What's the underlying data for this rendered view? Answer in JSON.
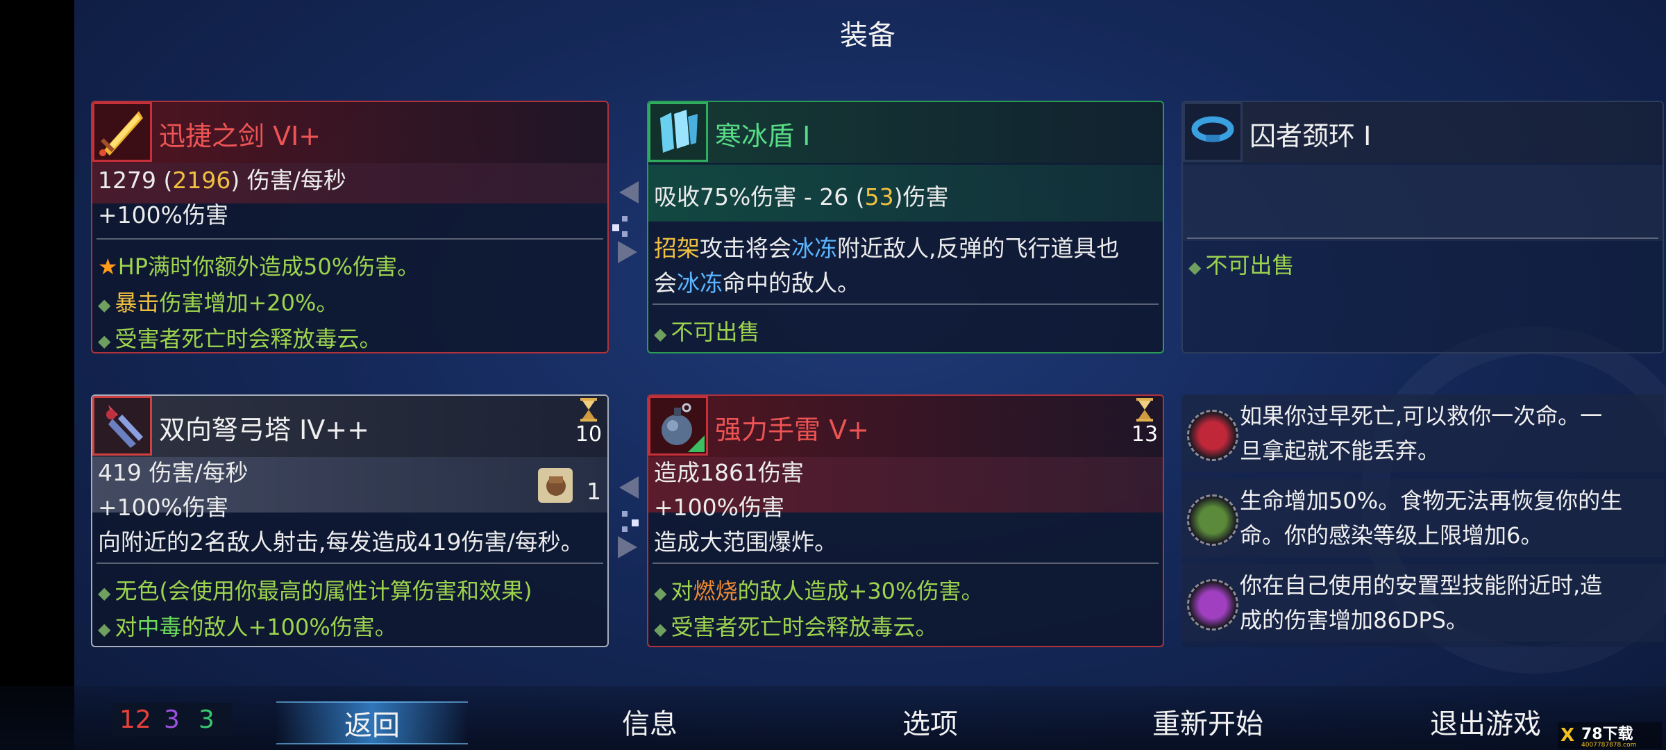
{
  "title": "装备",
  "weapon1": {
    "name": "迅捷之剑 VI+",
    "dps_prefix": "1279 (",
    "dps_crit": "2196",
    "dps_suffix": ") 伤害/每秒",
    "bonus": "+100%伤害",
    "perks": [
      {
        "marker": "★",
        "parts": [
          {
            "t": "HP满时你额外造成50%伤害。",
            "c": "perk"
          }
        ]
      },
      {
        "marker": "◆",
        "parts": [
          {
            "t": "暴击",
            "c": "gold"
          },
          {
            "t": "伤害增加+20%。",
            "c": "perk"
          }
        ]
      },
      {
        "marker": "◆",
        "parts": [
          {
            "t": "受害者死亡时会释放毒云。",
            "c": "perk"
          }
        ]
      }
    ]
  },
  "shield": {
    "name": "寒冰盾 I",
    "stat_prefix": "吸收75%伤害 - 26 (",
    "stat_crit": "53",
    "stat_suffix": ")伤害",
    "desc_line1": [
      {
        "t": "招架",
        "c": "gold"
      },
      {
        "t": "攻击将会",
        "c": ""
      },
      {
        "t": "冰冻",
        "c": "blue"
      },
      {
        "t": "附近敌人,反弹的飞行道具也",
        "c": ""
      }
    ],
    "desc_line2": [
      {
        "t": "会",
        "c": ""
      },
      {
        "t": "冰冻",
        "c": "blue"
      },
      {
        "t": "命中的敌人。",
        "c": ""
      }
    ],
    "note": "不可出售"
  },
  "amulet": {
    "name": "囚者颈环 I",
    "note": "不可出售"
  },
  "skill1": {
    "name": "双向弩弓塔 IV++",
    "cooldown": "10",
    "dps": "419 伤害/每秒",
    "bonus": "+100%伤害",
    "scroll_count": "1",
    "desc": "向附近的2名敌人射击,每发造成419伤害/每秒。",
    "perks": [
      {
        "parts": [
          {
            "t": "无色(会使用你最高的属性计算伤害和效果)",
            "c": "perk"
          }
        ]
      },
      {
        "parts": [
          {
            "t": "对",
            "c": "perk"
          },
          {
            "t": "中毒",
            "c": "green2"
          },
          {
            "t": "的敌人+100%伤害。",
            "c": "perk"
          }
        ]
      }
    ]
  },
  "skill2": {
    "name": "强力手雷 V+",
    "cooldown": "13",
    "damage": "造成1861伤害",
    "bonus": "+100%伤害",
    "desc": "造成大范围爆炸。",
    "perks": [
      {
        "parts": [
          {
            "t": "对",
            "c": "perk"
          },
          {
            "t": "燃烧",
            "c": "orange"
          },
          {
            "t": "的敌人造成+30%伤害。",
            "c": "perk"
          }
        ]
      },
      {
        "parts": [
          {
            "t": "受害者死亡时会释放毒云。",
            "c": "perk"
          }
        ]
      }
    ]
  },
  "mutations": [
    {
      "icon": "heart-mutation-icon",
      "color": "#c0283a",
      "line1": "如果你过早死亡,可以救你一次命。一",
      "line2": "旦拿起就不能丢弃。"
    },
    {
      "icon": "leaf-mutation-icon",
      "color": "#5a8a3a",
      "line1": "生命增加50%。食物无法再恢复你的生",
      "line2": "命。你的感染等级上限增加6。"
    },
    {
      "icon": "eye-mutation-icon",
      "color": "#a040c0",
      "line1": "你在自己使用的安置型技能附近时,造",
      "line2": "成的伤害增加86DPS。"
    }
  ],
  "scrolls": {
    "brutality": "12",
    "tactics": "3",
    "survival": "3",
    "colors": {
      "brutality": "#e8403a",
      "tactics": "#a050e0",
      "survival": "#3ac870"
    }
  },
  "nav": {
    "back": "返回",
    "info": "信息",
    "options": "选项",
    "restart": "重新开始",
    "quit": "退出游戏"
  },
  "watermark": {
    "big": "78下载",
    "small": "4007787878.com"
  }
}
